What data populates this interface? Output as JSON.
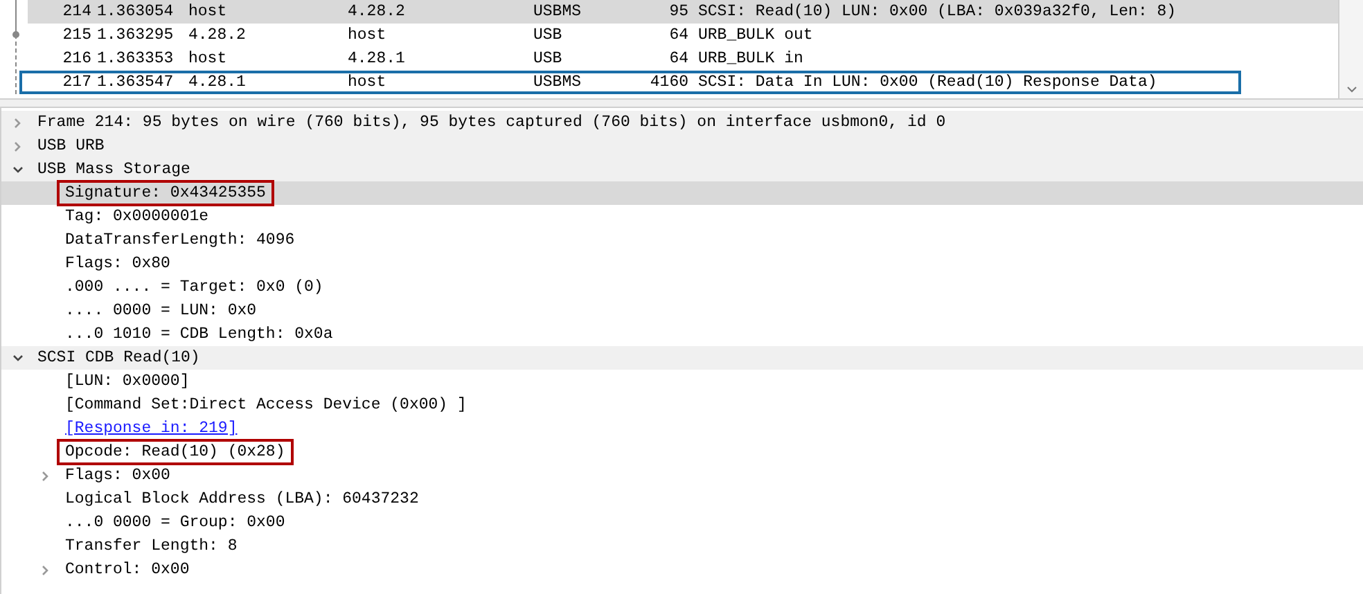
{
  "packets": [
    {
      "no": "214",
      "time": "1.363054",
      "source": "host",
      "destination": "4.28.2",
      "protocol": "USBMS",
      "length": "95",
      "info": "SCSI: Read(10) LUN: 0x00 (LBA: 0x039a32f0, Len: 8)",
      "selected": true,
      "focused": false
    },
    {
      "no": "215",
      "time": "1.363295",
      "source": "4.28.2",
      "destination": "host",
      "protocol": "USB",
      "length": "64",
      "info": "URB_BULK out",
      "selected": false,
      "focused": false
    },
    {
      "no": "216",
      "time": "1.363353",
      "source": "host",
      "destination": "4.28.1",
      "protocol": "USB",
      "length": "64",
      "info": "URB_BULK in",
      "selected": false,
      "focused": false
    },
    {
      "no": "217",
      "time": "1.363547",
      "source": "4.28.1",
      "destination": "host",
      "protocol": "USBMS",
      "length": "4160",
      "info": "SCSI: Data In LUN: 0x00 (Read(10) Response Data)",
      "selected": false,
      "focused": true
    }
  ],
  "details": [
    {
      "label": "Frame 214: 95 bytes on wire (760 bits), 95 bytes captured (760 bits) on interface usbmon0, id 0",
      "expanded": false
    },
    {
      "label": "USB URB",
      "expanded": false
    },
    {
      "label": "USB Mass Storage",
      "expanded": true,
      "children": [
        {
          "label": "Signature: 0x43425355",
          "selected": true,
          "highlighted": true
        },
        {
          "label": "Tag: 0x0000001e"
        },
        {
          "label": "DataTransferLength: 4096"
        },
        {
          "label": "Flags: 0x80"
        },
        {
          "label": ".000 .... = Target: 0x0 (0)"
        },
        {
          "label": ".... 0000 = LUN: 0x0"
        },
        {
          "label": "...0 1010 = CDB Length: 0x0a"
        }
      ]
    },
    {
      "label": "SCSI CDB Read(10)",
      "expanded": true,
      "children": [
        {
          "label": "[LUN: 0x0000]"
        },
        {
          "label": "[Command Set:Direct Access Device (0x00) ]"
        },
        {
          "label": "[Response in: 219]",
          "kind": "link"
        },
        {
          "label": "Opcode: Read(10) (0x28)",
          "highlighted": true
        },
        {
          "label": "Flags: 0x00",
          "expanded": false
        },
        {
          "label": "Logical Block Address (LBA): 60437232"
        },
        {
          "label": "...0 0000 = Group: 0x00"
        },
        {
          "label": "Transfer Length: 8"
        },
        {
          "label": "Control: 0x00",
          "expanded": false
        }
      ]
    }
  ]
}
